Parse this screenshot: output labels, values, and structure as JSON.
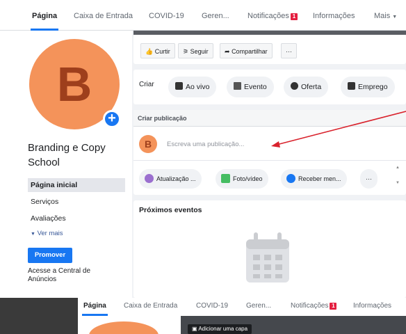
{
  "nav": {
    "tabs": [
      "Página",
      "Caixa de Entrada",
      "COVID-19",
      "Geren...",
      "Notificações",
      "Informações",
      "Mais"
    ],
    "notif_badge": "1"
  },
  "profile": {
    "avatar_letter": "B",
    "name": "Branding e Copy School"
  },
  "sidebar": {
    "items": [
      "Página inicial",
      "Serviços",
      "Avaliações"
    ],
    "more": "Ver mais",
    "promote": "Promover",
    "central": "Acesse a Central de Anúncios"
  },
  "actions": {
    "curtir": "Curtir",
    "seguir": "Seguir",
    "compartilhar": "Compartilhar",
    "more": "···"
  },
  "create": {
    "label": "Criar",
    "buttons": [
      "Ao vivo",
      "Evento",
      "Oferta",
      "Emprego"
    ]
  },
  "post": {
    "header": "Criar publicação",
    "avatar_letter": "B",
    "placeholder": "Escreva uma publicação...",
    "buttons": [
      "Atualização ...",
      "Foto/vídeo",
      "Receber men..."
    ],
    "more": "···"
  },
  "events": {
    "title": "Próximos eventos"
  },
  "bottom_nav": {
    "tabs": [
      "Página",
      "Caixa de Entrada",
      "COVID-19",
      "Geren...",
      "Notificações",
      "Informações"
    ],
    "notif_badge": "1",
    "cover_button": "Adicionar uma capa"
  },
  "colors": {
    "accent": "#1877f2",
    "avatar": "#f4935a",
    "annotation_arrow": "#d9232d"
  }
}
